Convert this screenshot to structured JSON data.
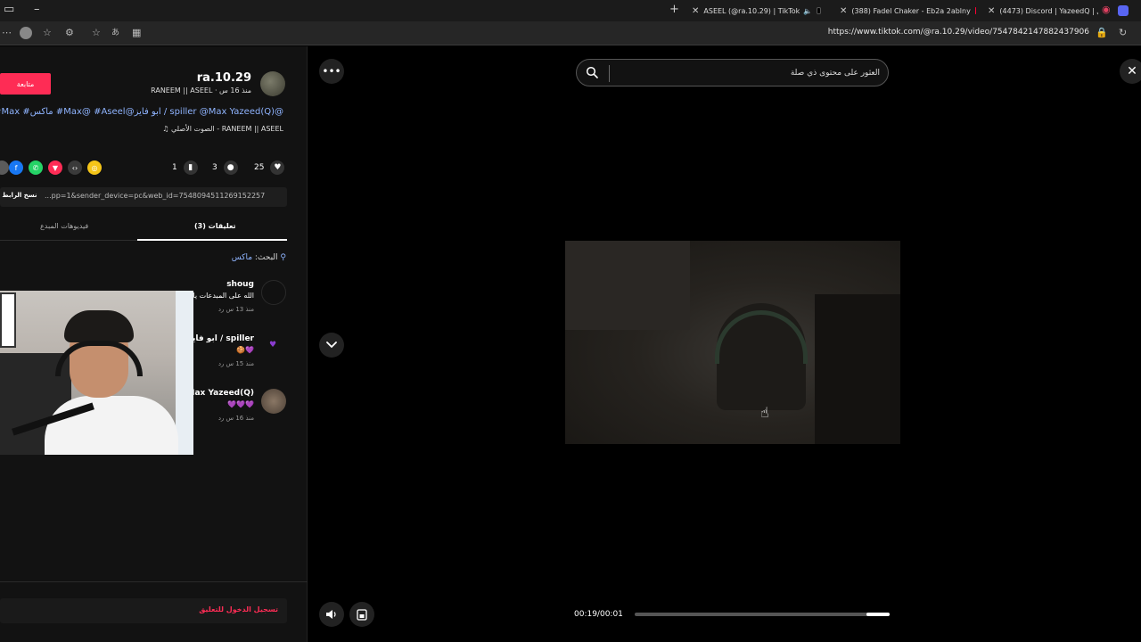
{
  "browser": {
    "tabs": [
      {
        "title": "ASEEL (@ra.10.29) | TikTok",
        "icon": "tiktok-icon"
      },
      {
        "title": "(388) Fadel Chaker - Eb2a 2ablny",
        "icon": "youtube-icon"
      },
      {
        "title": "(4473) Discord | YazeedQ | ي...",
        "icon": "discord-icon"
      }
    ],
    "url": "https://www.tiktok.com/@ra.10.29/video/7547842147882437906"
  },
  "panel": {
    "follow_label": "متابعة",
    "username": "ra.10.29",
    "subline": "RANEEM || ASEEL · منذ 16 س",
    "caption": "#Max #ماكس #Max@ #Aseel@ابو فايز / spiller @Max Yazeed(Q)@",
    "music": "♫ الصوت الأصلي - RANEEM || ASEEL",
    "likes": "25",
    "comments": "3",
    "saves": "1",
    "copy_link_label": "نسخ الرابط",
    "link_text": "...pp=1&sender_device=pc&web_id=7548094511269152257",
    "tab_comments": "(3) تعليقات",
    "tab_creator_videos": "فيديوهات المبدع",
    "search_prefix": "البحث:",
    "search_keyword": "ماكس",
    "comments_list": [
      {
        "name": "shoug",
        "text": "الله على المبدعات يا",
        "meta": "منذ 13 س     رد"
      },
      {
        "name": "ابو فايز / spiller",
        "text": "🍪💜",
        "meta": "منذ 15 س     رد"
      },
      {
        "name": "Max Yazeed(Q)",
        "text": "💜💜💜",
        "meta": "منذ 16 س     رد"
      }
    ],
    "login_label": "تسجيل الدخول للتعليق"
  },
  "main": {
    "search_placeholder": "العثور على محتوى ذي صلة",
    "time": "00:19/00:01",
    "progress_fraction": 0.09
  },
  "colors": {
    "accent": "#fe2c55",
    "link": "#8fb4ff"
  }
}
